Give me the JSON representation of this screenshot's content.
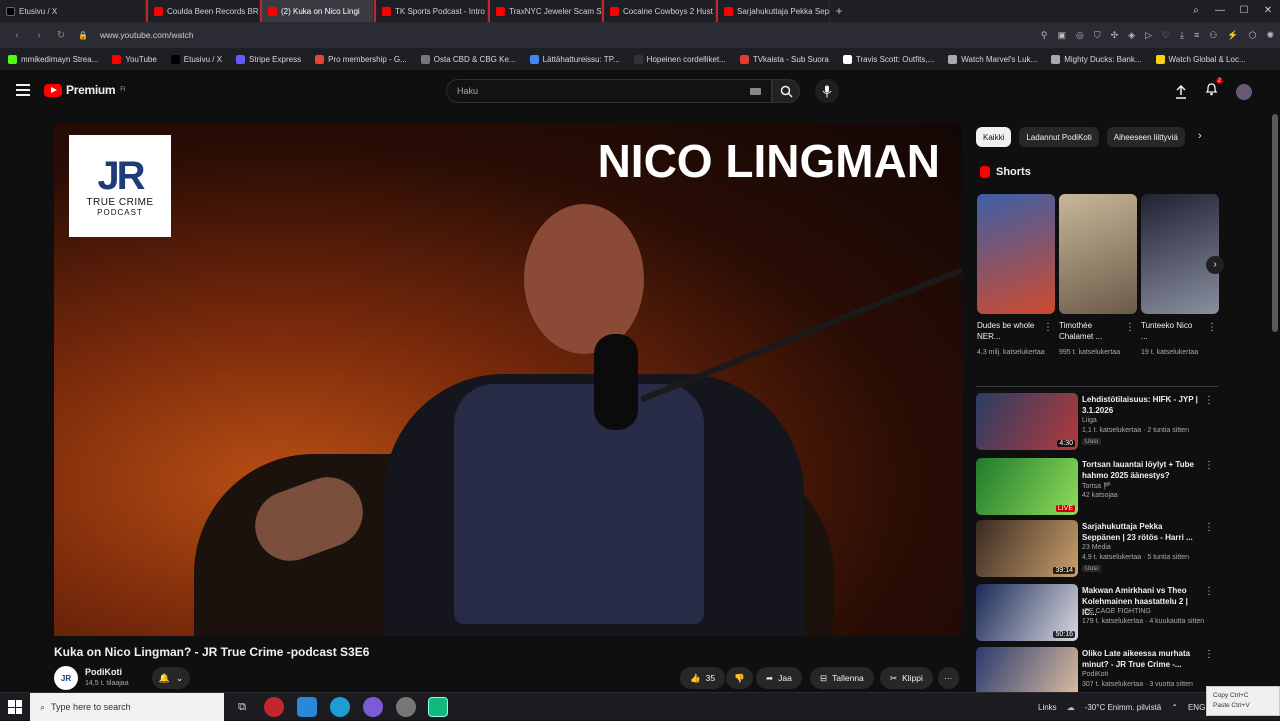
{
  "browser": {
    "tabs": [
      {
        "label": "Etusivu / X",
        "color": "#000000",
        "pinned": true
      },
      {
        "label": "Coulda Been Records BRO",
        "color": "#ff0000"
      },
      {
        "label": "(2) Kuka on Nico Lingi",
        "color": "#ff0000",
        "active": true
      },
      {
        "label": "TK Sports Podcast - Intro",
        "color": "#ff0000"
      },
      {
        "label": "TraxNYC Jeweler Scam Sit",
        "color": "#ff0000"
      },
      {
        "label": "Cocaine Cowboys 2 Hust",
        "color": "#ff0000"
      },
      {
        "label": "Sarjahukuttaja Pekka Sepp",
        "color": "#ff0000"
      }
    ],
    "new_tab": "+",
    "url": "www.youtube.com/watch",
    "bookmarks": [
      {
        "label": "mmikedimayn Strea...",
        "color": "#53fc18"
      },
      {
        "label": "YouTube",
        "color": "#ff0000"
      },
      {
        "label": "Etusivu / X",
        "color": "#000000"
      },
      {
        "label": "Stripe Express",
        "color": "#635bff"
      },
      {
        "label": "Pro membership - G...",
        "color": "#ea4335"
      },
      {
        "label": "Osta CBD & CBG Ke...",
        "color": "#777777"
      },
      {
        "label": "Lättähattureissu: TP...",
        "color": "#4285f4"
      },
      {
        "label": "Hopeinen cordelliket...",
        "color": "#333333"
      },
      {
        "label": "TVkaista - Sub Suora",
        "color": "#e53935"
      },
      {
        "label": "Travis Scott: Outfits,...",
        "color": "#ffffff"
      },
      {
        "label": "Watch Marvel's Luk...",
        "color": "#aaaaaa"
      },
      {
        "label": "Mighty Ducks: Bank...",
        "color": "#aaaaaa"
      },
      {
        "label": "Watch Global & Loc...",
        "color": "#ffd600"
      }
    ]
  },
  "youtube": {
    "logo_text": "Premium",
    "logo_sup": "FI",
    "search_placeholder": "Haku",
    "notification_count": "2",
    "video": {
      "overlay_title": "NICO LINGMAN",
      "logo_jr": "JR",
      "logo_line1": "TRUE CRIME",
      "logo_line2": "PODCAST",
      "title": "Kuka on Nico Lingman? - JR True Crime -podcast S3E6",
      "channel": "PodiKoti",
      "subscribers": "14,5 t. tilaajaa",
      "channel_avatar": "JR",
      "likes": "35",
      "share": "Jaa",
      "save": "Tallenna",
      "clip": "Klippi",
      "more": "···"
    },
    "chips": [
      {
        "label": "Kaikki",
        "active": true
      },
      {
        "label": "Ladannut PodiKoti"
      },
      {
        "label": "Aiheeseen liittyviä"
      }
    ],
    "shorts_header": "Shorts",
    "shorts": [
      {
        "title": "Dudes be whole NER...",
        "views": "4,3 milj. katselukertaa",
        "colors": [
          "#3b5fa8",
          "#d04a2e"
        ]
      },
      {
        "title": "Timothée Chalamet ...",
        "views": "995 t. katselukertaa",
        "colors": [
          "#c9b79a",
          "#6b5a48"
        ]
      },
      {
        "title": "Tunteeko Nico ...",
        "views": "19 t. katselukertaa",
        "colors": [
          "#1e2233",
          "#8a8fa0"
        ]
      }
    ],
    "recommendations": [
      {
        "title": "Lehdistötilaisuus: HIFK - JYP | 3.1.2026",
        "channel": "Liiga",
        "meta": "1,1 t. katselukertaa · 2 tuntia sitten",
        "badge": "Uusi",
        "duration": "4:30",
        "live": false,
        "colors": [
          "#2a3d66",
          "#b23a3a"
        ]
      },
      {
        "title": "Tortsan lauantai löylyt + Tube hahmo 2025 äänestys?",
        "channel": "Tortsa 🏴",
        "meta": "42 katsojaa",
        "badge": "",
        "duration": "LIVE",
        "live": true,
        "colors": [
          "#1f7a2c",
          "#8fdc5a"
        ]
      },
      {
        "title": "Sarjahukuttaja Pekka Seppänen | 23 rötös - Harri ...",
        "channel": "23 Media",
        "meta": "4,9 t. katselukertaa · 5 tuntia sitten",
        "badge": "Uusi",
        "duration": "39:14",
        "live": false,
        "colors": [
          "#3a2a22",
          "#c9a06a"
        ]
      },
      {
        "title": "Makwan Amirkhani vs Theo Kolehmainen haastattelu 2 | IC...",
        "channel": "ICE CAGE FIGHTING",
        "meta": "179 t. katselukertaa · 4 kuukautta sitten",
        "badge": "",
        "duration": "50:16",
        "live": false,
        "colors": [
          "#1a2a55",
          "#d8d8e0"
        ]
      },
      {
        "title": "Oliko Late aikeessa murhata minut? - JR True Crime -...",
        "channel": "PodiKoti",
        "meta": "307 t. katselukertaa · 3 vuotta sitten",
        "badge": "",
        "duration": "",
        "live": false,
        "colors": [
          "#2a3a70",
          "#e0c0a0"
        ]
      }
    ]
  },
  "taskbar": {
    "search_placeholder": "Type here to search",
    "links": "Links",
    "weather": "-30°C  Enimm. pilvistä",
    "lang": "ENG"
  },
  "clipboard": {
    "line1": "Copy  Ctrl+C",
    "line2": "Paste  Ctrl+V"
  }
}
